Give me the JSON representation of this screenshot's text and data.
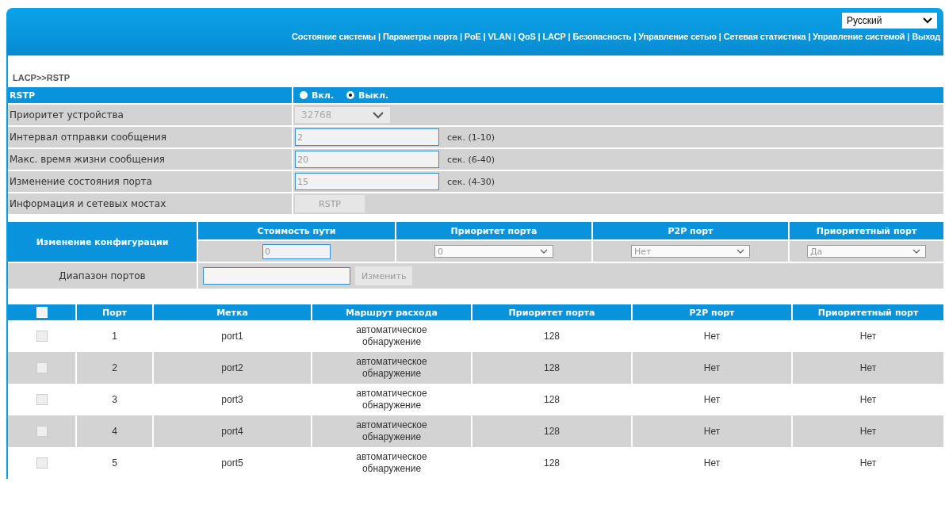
{
  "language_select": {
    "value": "Русский"
  },
  "nav": {
    "separator": "|",
    "items": [
      "Состояние системы",
      "Параметры порта",
      "PoE",
      "VLAN",
      "QoS",
      "LACP",
      "Безопасность",
      "Управление сетью",
      "Сетевая статистика",
      "Управление системой",
      "Выход"
    ]
  },
  "breadcrumb": "LACP>>RSTP",
  "rstp": {
    "label": "RSTP",
    "options": [
      {
        "label": "Вкл.",
        "selected": false
      },
      {
        "label": "Выкл.",
        "selected": true
      }
    ]
  },
  "settings": [
    {
      "kind": "select",
      "label": "Приоритет устройства",
      "value": "32768",
      "disabled": true
    },
    {
      "kind": "input",
      "label": "Интервал отправки сообщения",
      "value": "2",
      "unit": "сек. (1-10)"
    },
    {
      "kind": "input",
      "label": "Макс. время жизни сообщения",
      "value": "20",
      "unit": "сек. (6-40)"
    },
    {
      "kind": "input",
      "label": "Изменение состояния порта",
      "value": "15",
      "unit": "сек. (4-30)"
    },
    {
      "kind": "button",
      "label": "Информация и сетевых мостах",
      "value": "RSTP",
      "disabled": true
    }
  ],
  "config": {
    "title": "Изменение конфигурации",
    "columns": [
      {
        "label": "Стоимость пути",
        "kind": "input",
        "value": "0"
      },
      {
        "label": "Приоритет порта",
        "kind": "select",
        "value": "0"
      },
      {
        "label": "P2P порт",
        "kind": "select",
        "value": "Нет"
      },
      {
        "label": "Приоритетный порт",
        "kind": "select",
        "value": "Да"
      }
    ],
    "range_label": "Диапазон портов",
    "apply_button": {
      "label": "Изменить",
      "disabled": true
    }
  },
  "ports": {
    "select_all": {
      "checked": false
    },
    "columns": [
      "Порт",
      "Метка",
      "Маршрут расхода",
      "Приоритет порта",
      "P2P порт",
      "Приоритетный порт"
    ],
    "rows": [
      {
        "checked": false,
        "cells": [
          "1",
          "port1",
          "автоматическое обнаружение",
          "128",
          "Нет",
          "Нет"
        ]
      },
      {
        "checked": false,
        "cells": [
          "2",
          "port2",
          "автоматическое обнаружение",
          "128",
          "Нет",
          "Нет"
        ]
      },
      {
        "checked": false,
        "cells": [
          "3",
          "port3",
          "автоматическое обнаружение",
          "128",
          "Нет",
          "Нет"
        ]
      },
      {
        "checked": false,
        "cells": [
          "4",
          "port4",
          "автоматическое обнаружение",
          "128",
          "Нет",
          "Нет"
        ]
      },
      {
        "checked": false,
        "cells": [
          "5",
          "port5",
          "автоматическое обнаружение",
          "128",
          "Нет",
          "Нет"
        ]
      }
    ]
  }
}
